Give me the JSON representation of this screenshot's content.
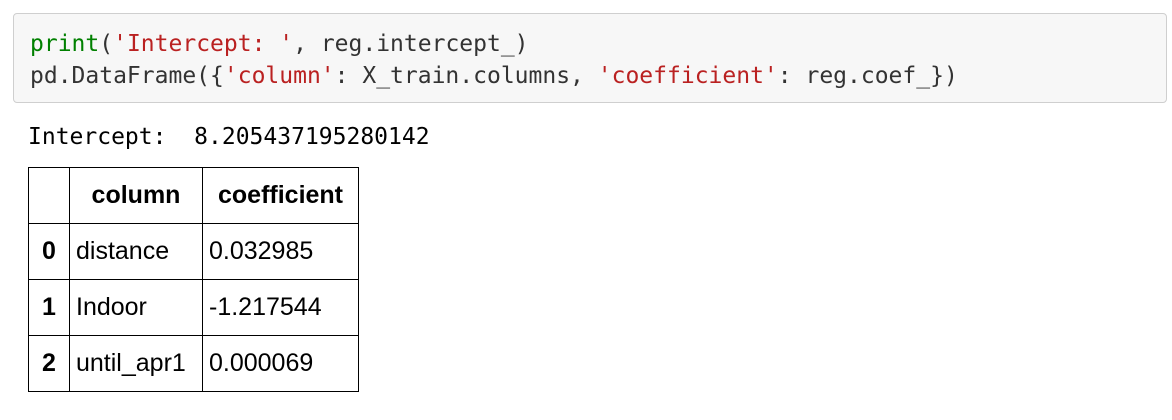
{
  "code_cell": {
    "line1": {
      "fn": "print",
      "open": "(",
      "string": "'Intercept: '",
      "rest": ", reg.intercept_)"
    },
    "line2": {
      "prefix": "pd.DataFrame({",
      "key1": "'column'",
      "mid1": ": X_train.columns, ",
      "key2": "'coefficient'",
      "mid2": ": reg.coef_})"
    }
  },
  "output": {
    "text": "Intercept:  8.205437195280142"
  },
  "dataframe": {
    "columns": [
      "",
      "column",
      "coefficient"
    ],
    "rows": [
      {
        "index": "0",
        "column": "distance",
        "coefficient": "0.032985"
      },
      {
        "index": "1",
        "column": "Indoor",
        "coefficient": "-1.217544"
      },
      {
        "index": "2",
        "column": "until_apr1",
        "coefficient": "0.000069"
      }
    ]
  },
  "colors": {
    "keyword": "#008000",
    "string": "#ba2121",
    "cell_background": "#f7f7f7",
    "cell_border": "#cfcfcf"
  }
}
